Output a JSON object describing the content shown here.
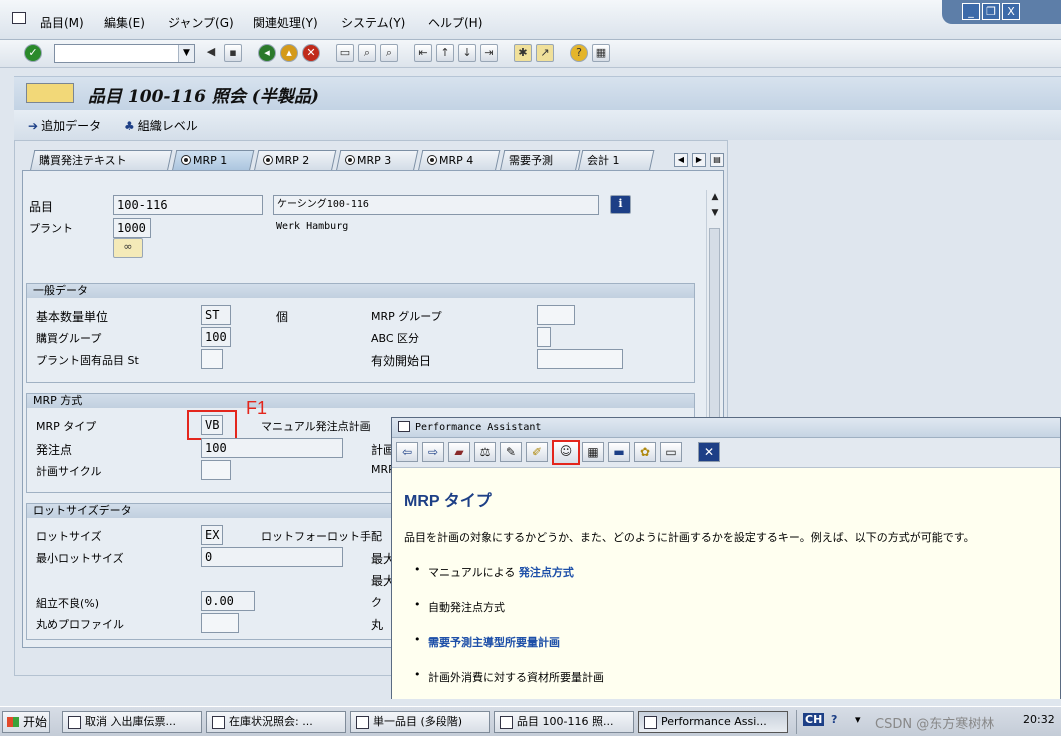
{
  "menu": {
    "items": [
      "品目(M)",
      "編集(E)",
      "ジャンプ(G)",
      "関連処理(Y)",
      "システム(Y)",
      "ヘルプ(H)"
    ]
  },
  "window_controls": {
    "minimize": "_",
    "restore": "❐",
    "close": "X"
  },
  "toolbar": {
    "command_field_value": "",
    "icons": [
      "enter-icon",
      "back-icon",
      "save-icon",
      "back-green-icon",
      "exit-icon",
      "cancel-icon",
      "print-icon",
      "find-icon",
      "find-next-icon",
      "first-page-icon",
      "prev-page-icon",
      "next-page-icon",
      "last-page-icon",
      "new-session-icon",
      "shortcut-icon",
      "help-icon",
      "customize-layout-icon"
    ]
  },
  "header": {
    "title": "品目 100-116 照会 (半製品)",
    "additional_data_label": "追加データ",
    "org_levels_label": "組織レベル"
  },
  "tabs": [
    {
      "label": "購買発注テキスト",
      "active": false,
      "radio": false
    },
    {
      "label": "MRP 1",
      "active": true,
      "radio": true
    },
    {
      "label": "MRP 2",
      "active": false,
      "radio": true
    },
    {
      "label": "MRP 3",
      "active": false,
      "radio": true
    },
    {
      "label": "MRP 4",
      "active": false,
      "radio": true
    },
    {
      "label": "需要予測",
      "active": false,
      "radio": false
    },
    {
      "label": "会計 1",
      "active": false,
      "radio": false
    }
  ],
  "material": {
    "material_label": "品目",
    "material_value": "100-116",
    "description_value": "ケーシング100-116",
    "plant_label": "プラント",
    "plant_value": "1000",
    "plant_name": "Werk Hamburg"
  },
  "general_data": {
    "title": "一般データ",
    "base_uom_label": "基本数量単位",
    "base_uom_value": "ST",
    "base_uom_text": "個",
    "purchasing_group_label": "購買グループ",
    "purchasing_group_value": "100",
    "plant_status_label": "プラント固有品目 St",
    "plant_status_value": "",
    "mrp_group_label": "MRP グループ",
    "mrp_group_value": "",
    "abc_label": "ABC 区分",
    "abc_value": "",
    "valid_from_label": "有効開始日",
    "valid_from_value": ""
  },
  "mrp_procedure": {
    "title": "MRP 方式",
    "mrp_type_label": "MRP タイプ",
    "mrp_type_value": "VB",
    "mrp_type_text": "マニュアル発注点計画",
    "reorder_point_label": "発注点",
    "reorder_point_value": "100",
    "planning_cycle_label": "計画サイクル",
    "planning_cycle_value": "",
    "right_label_1": "計画",
    "right_label_2": "MRP",
    "annotation": "F1"
  },
  "lot_size": {
    "title": "ロットサイズデータ",
    "lot_size_label": "ロットサイズ",
    "lot_size_value": "EX",
    "lot_size_text": "ロットフォーロット手配",
    "min_lot_label": "最小ロットサイズ",
    "min_lot_value": "0",
    "max_label_1": "最大",
    "max_label_2": "最大",
    "assembly_scrap_label": "組立不良(%)",
    "assembly_scrap_value": "0.00",
    "right_label_3": "ク",
    "rounding_profile_label": "丸めプロファイル",
    "rounding_profile_value": "",
    "right_label_4": "丸"
  },
  "performance_assistant": {
    "window_title": "Performance Assistant",
    "heading": "MRP タイプ",
    "description": "品目を計画の対象にするかどうか、また、どのように計画するかを設定するキー。例えば、以下の方式が可能です。",
    "items": [
      {
        "prefix": "マニュアルによる ",
        "link": "発注点方式"
      },
      {
        "prefix": "自動発注点方式",
        "link": ""
      },
      {
        "prefix": "",
        "link": "需要予測主導型所要量計画"
      },
      {
        "prefix": "計画外消費に対する資材所要量計画",
        "link": ""
      }
    ],
    "tool_icons": [
      "back-icon",
      "forward-icon",
      "book-icon",
      "technical-info-icon",
      "edit-icon",
      "marker-icon",
      "user-help-icon",
      "table-icon",
      "comment-icon",
      "settings-icon",
      "print-icon",
      "close-icon"
    ]
  },
  "taskbar": {
    "start_label": "开始",
    "tasks": [
      "取消 入出庫伝票...",
      "在庫状況照会: ...",
      "単一品目 (多段階)",
      "品目 100-116 照...",
      "Performance Assi..."
    ],
    "lang": "CH",
    "watermark": "CSDN @东方寒树林",
    "clock": "20:32"
  },
  "colors": {
    "accent": "#1d3f86",
    "highlight": "#e3261c"
  }
}
